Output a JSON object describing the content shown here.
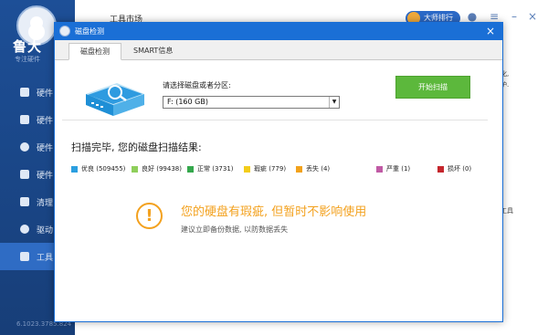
{
  "app": {
    "brand": "鲁大",
    "brand_sub": "专注硬件",
    "version": "6.1023.3785.824",
    "header_title": "工具市场",
    "rank_badge": "大师排行",
    "nav": [
      "硬件",
      "硬件",
      "硬件",
      "硬件",
      "清理",
      "驱动",
      "工具"
    ],
    "peek_texts": [
      "化,",
      "护.",
      "工具"
    ]
  },
  "dialog": {
    "title": "磁盘检测",
    "close_glyph": "×",
    "tabs": [
      "磁盘检测",
      "SMART信息"
    ],
    "select_label": "请选择磁盘或者分区:",
    "select_value": "F: (160 GB)",
    "select_arrow": "▼",
    "scan_button": "开始扫描",
    "result_title": "扫描完毕, 您的磁盘扫描结果:",
    "legend": [
      {
        "label": "优良",
        "count": "(509455)",
        "color": "#2b9fe0"
      },
      {
        "label": "良好",
        "count": "(99438)",
        "color": "#8fcf5b"
      },
      {
        "label": "正常",
        "count": "(3731)",
        "color": "#35a84d"
      },
      {
        "label": "瑕疵",
        "count": "(779)",
        "color": "#f3cd1b"
      },
      {
        "label": "丢失",
        "count": "(4)",
        "color": "#f2a21c"
      },
      {
        "label": "严重",
        "count": "(1)",
        "color": "#c05aa5"
      },
      {
        "label": "损坏",
        "count": "(0)",
        "color": "#c5262c"
      }
    ],
    "warning": {
      "icon": "!",
      "main": "您的硬盘有瑕疵, 但暂时不影响使用",
      "sub": "建议立即备份数据, 以防数据丢失"
    }
  },
  "colors": {
    "accent_blue": "#1a6fd6",
    "scan_green": "#5cb83c",
    "warning_orange": "#f3a11e"
  }
}
